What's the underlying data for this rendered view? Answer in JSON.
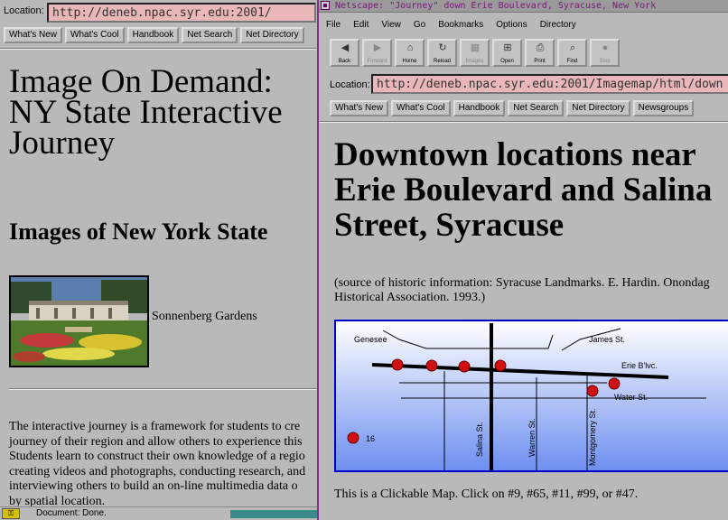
{
  "back_window": {
    "location_label": "Location:",
    "location_url": "http://deneb.npac.syr.edu:2001/",
    "directory_buttons": [
      "What's New",
      "What's Cool",
      "Handbook",
      "Net Search",
      "Net Directory"
    ],
    "title_lines": [
      "Image On Demand:",
      "NY State Interactive",
      "Journey"
    ],
    "subtitle": "Images of New York State",
    "photo_caption": "Sonnenberg Gardens",
    "paragraph_lines": [
      "The interactive journey is a framework for students to cre",
      "journey of their region and allow others to experience this",
      "Students learn to construct their own knowledge of a regio",
      "creating videos and photographs, conducting research, and",
      "interviewing others to build an on-line multimedia data o",
      "by spatial location."
    ],
    "status_text": "Document: Done."
  },
  "front_window": {
    "title_bar": "Netscape: \"Journey\" down  Erie Boulevard, Syracuse, New York",
    "menu": [
      "File",
      "Edit",
      "View",
      "Go",
      "Bookmarks",
      "Options",
      "Directory"
    ],
    "toolbar": [
      {
        "label": "Back",
        "icon": "back-arrow-icon",
        "glyph": "◀",
        "enabled": true
      },
      {
        "label": "Forward",
        "icon": "forward-arrow-icon",
        "glyph": "▶",
        "enabled": false
      },
      {
        "label": "Home",
        "icon": "home-icon",
        "glyph": "⌂",
        "enabled": true
      },
      {
        "label": "Reload",
        "icon": "reload-icon",
        "glyph": "↻",
        "enabled": true
      },
      {
        "label": "Images",
        "icon": "images-icon",
        "glyph": "▦",
        "enabled": false
      },
      {
        "label": "Open",
        "icon": "open-icon",
        "glyph": "⊞",
        "enabled": true
      },
      {
        "label": "Print",
        "icon": "print-icon",
        "glyph": "⎙",
        "enabled": true
      },
      {
        "label": "Find",
        "icon": "find-icon",
        "glyph": "⌕",
        "enabled": true
      },
      {
        "label": "Stop",
        "icon": "stop-icon",
        "glyph": "●",
        "enabled": false
      }
    ],
    "location_label": "Location:",
    "location_url": "http://deneb.npac.syr.edu:2001/Imagemap/html/down",
    "directory_buttons": [
      "What's New",
      "What's Cool",
      "Handbook",
      "Net Search",
      "Net Directory",
      "Newsgroups"
    ],
    "title_lines": [
      "Downtown locations near",
      "Erie Boulevard and Salina",
      "Street, Syracuse"
    ],
    "source_lines": [
      "(source of historic information: Syracuse Landmarks. E. Hardin. Onondag",
      "Historical Association. 1993.)"
    ],
    "map": {
      "street_labels": {
        "genesee": "Genesee",
        "james": "James St.",
        "erie": "Erie B'lvc.",
        "water": "Water St.",
        "salina": "Salina St.",
        "warren": "Warren St.",
        "montgomery": "Montgomery St."
      },
      "marker_label": "16",
      "colors": {
        "top": "#ffffff",
        "bottom": "#6e8ff0",
        "marker": "#d01010",
        "border": "#0000cc"
      }
    },
    "map_caption": "This is a Clickable Map. Click on #9, #65, #11, #99, or #47."
  }
}
